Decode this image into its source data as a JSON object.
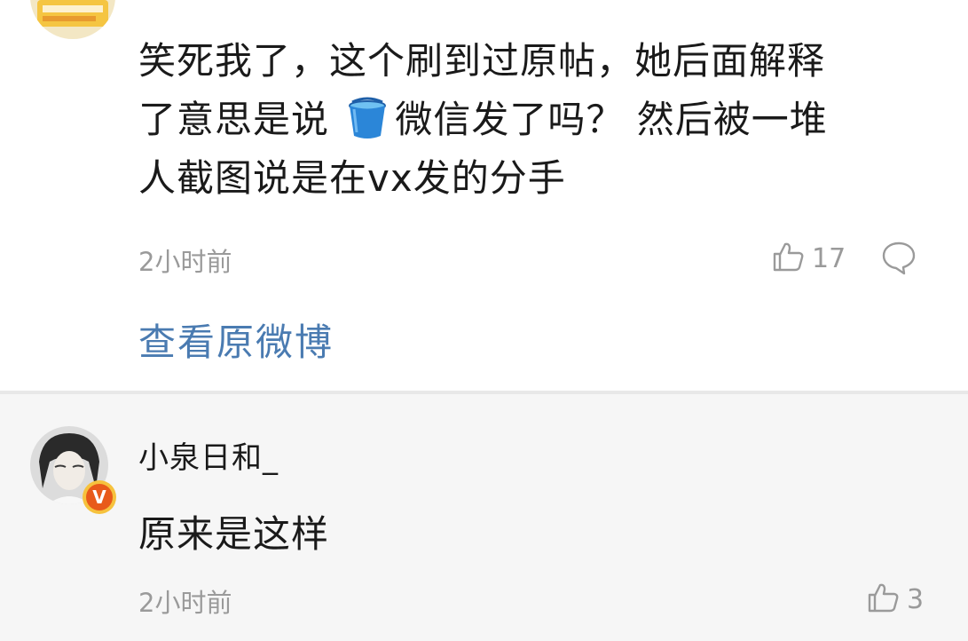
{
  "colors": {
    "link": "#4a7bb1",
    "meta_gray": "#9a9a9a",
    "reply_bg": "#f6f6f6",
    "badge": "#e85a1a"
  },
  "comment": {
    "line1": "笑死我了，这个刷到过原帖，她后面解释",
    "line2_before_icon": "了意思是说 ",
    "emoji": "bucket-icon",
    "line2_after_icon": "微信发了吗？ 然后被一堆",
    "line3": "人截图说是在vx发的分手",
    "timestamp": "2小时前",
    "like_count": "17",
    "view_original": "查看原微博"
  },
  "reply": {
    "username": "小泉日和_",
    "badge": "V",
    "text": "原来是这样",
    "timestamp": "2小时前",
    "like_count": "3"
  }
}
